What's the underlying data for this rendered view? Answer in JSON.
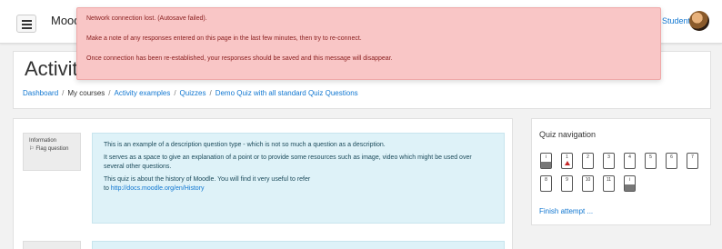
{
  "header": {
    "brand": "Mood",
    "user_name": "Student",
    "menu_icon": "hamburger-menu-icon",
    "avatar_icon": "user-avatar"
  },
  "alert": {
    "line1": "Network connection lost. (Autosave failed).",
    "line2": "Make a note of any responses entered on this page in the last few minutes, then try to re-connect.",
    "line3": "Once connection has been re-established, your responses should be saved and this message will disappear."
  },
  "page": {
    "title": "Activit",
    "breadcrumb": [
      "Dashboard",
      "My courses",
      "Activity examples",
      "Quizzes",
      "Demo Quiz with all standard Quiz Questions"
    ]
  },
  "question": {
    "info_label": "Information",
    "flag_label": "Flag question",
    "flag_icon": "flag-icon",
    "p1": "This is an example of a description question type - which is not so much a question as a description.",
    "p2": "It serves as a space to give an explanation of a point or to provide some resources such as image, video which might be used over several other questions.",
    "p3_prefix": "This quiz is about the history of Moodle. You will find it very useful to refer",
    "p3_to": "to",
    "p3_link": "http://docs.moodle.org/en/History"
  },
  "quiz_nav": {
    "title": "Quiz navigation",
    "buttons": [
      {
        "num": "i",
        "state": "answered",
        "flagged": false
      },
      {
        "num": "1",
        "state": "current",
        "flagged": true
      },
      {
        "num": "2",
        "state": "empty",
        "flagged": false
      },
      {
        "num": "3",
        "state": "empty",
        "flagged": false
      },
      {
        "num": "4",
        "state": "empty",
        "flagged": false
      },
      {
        "num": "5",
        "state": "empty",
        "flagged": false
      },
      {
        "num": "6",
        "state": "empty",
        "flagged": false
      },
      {
        "num": "7",
        "state": "empty",
        "flagged": false
      },
      {
        "num": "8",
        "state": "empty",
        "flagged": false
      },
      {
        "num": "9",
        "state": "empty",
        "flagged": false
      },
      {
        "num": "10",
        "state": "empty",
        "flagged": false
      },
      {
        "num": "11",
        "state": "empty",
        "flagged": false
      },
      {
        "num": "i",
        "state": "answered",
        "flagged": false
      }
    ],
    "finish_link": "Finish attempt ..."
  }
}
